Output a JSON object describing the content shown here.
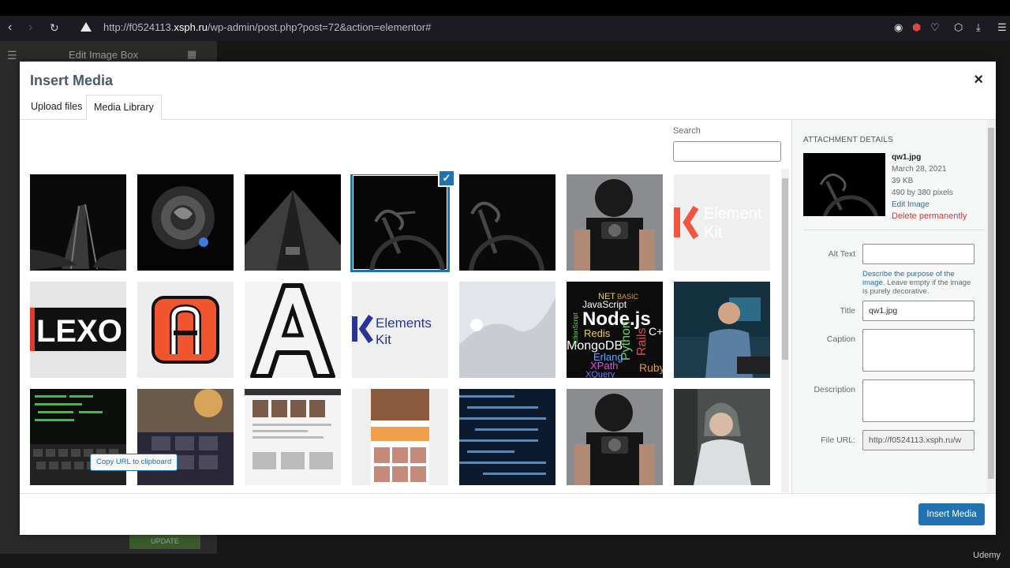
{
  "browser": {
    "url_prefix": "http://f0524113.",
    "url_domain": "xsph.ru",
    "url_path": "/wp-admin/post.php?post=72&action=elementor#"
  },
  "editor": {
    "panel_title": "Edit Image Box",
    "update_label": "UPDATE",
    "watermark": "Udemy"
  },
  "modal": {
    "title": "Insert Media",
    "close_icon": "×",
    "tabs": [
      {
        "label": "Upload files"
      },
      {
        "label": "Media Library"
      }
    ],
    "search_label": "Search",
    "search_value": "",
    "insert_button": "Insert Media"
  },
  "library": {
    "items": [
      {
        "name": "hands-dark",
        "selected": false
      },
      {
        "name": "rose",
        "selected": false
      },
      {
        "name": "building",
        "selected": false
      },
      {
        "name": "bike-dark",
        "selected": true
      },
      {
        "name": "bike-dark-2",
        "selected": false
      },
      {
        "name": "photographer",
        "selected": false
      },
      {
        "name": "elementskit-logo",
        "selected": false
      },
      {
        "name": "lexo",
        "selected": false
      },
      {
        "name": "a-orange",
        "selected": false
      },
      {
        "name": "a-outline",
        "selected": false
      },
      {
        "name": "elementskit-logo-2",
        "selected": false
      },
      {
        "name": "placeholder",
        "selected": false
      },
      {
        "name": "nodejs-words",
        "selected": false
      },
      {
        "name": "man-computer",
        "selected": false
      },
      {
        "name": "keyboard-code",
        "selected": false
      },
      {
        "name": "website-dark",
        "selected": false
      },
      {
        "name": "website-light",
        "selected": false
      },
      {
        "name": "website-orange",
        "selected": false
      },
      {
        "name": "code-blue",
        "selected": false
      },
      {
        "name": "photographer-2",
        "selected": false
      },
      {
        "name": "woman-portrait",
        "selected": false
      }
    ],
    "elementskit_line1": "Element",
    "elementskit_line2": "Kit",
    "elementskit2_line1": "Elements",
    "elementskit2_line2": "Kit",
    "lexo_text": "LEXO",
    "node_words": [
      "NET",
      "BASIC",
      "JavaScript",
      "Node.js",
      "Redis",
      "Python",
      "Rails",
      "C++",
      "MongoDB",
      "Erlang",
      "XPath",
      "Ruby",
      "XQuery",
      "ActionScript"
    ]
  },
  "details": {
    "heading": "ATTACHMENT DETAILS",
    "filename": "qw1.jpg",
    "date": "March 28, 2021",
    "size": "39 KB",
    "dimensions": "490 by 380 pixels",
    "edit_link": "Edit Image",
    "delete_link": "Delete permanently",
    "alt_label": "Alt Text",
    "alt_value": "",
    "alt_help_link": "Describe the purpose of the image",
    "alt_help_rest": ". Leave empty if the image is purely decorative.",
    "title_label": "Title",
    "title_value": "qw1.jpg",
    "caption_label": "Caption",
    "caption_value": "",
    "description_label": "Description",
    "description_value": "",
    "file_url_label": "File URL:",
    "file_url_value": "http://f0524113.xsph.ru/w",
    "copy_button": "Copy URL to clipboard"
  },
  "colors": {
    "accent": "#2271b1",
    "danger": "#d63638",
    "modal_title": "#4b5a6b"
  }
}
